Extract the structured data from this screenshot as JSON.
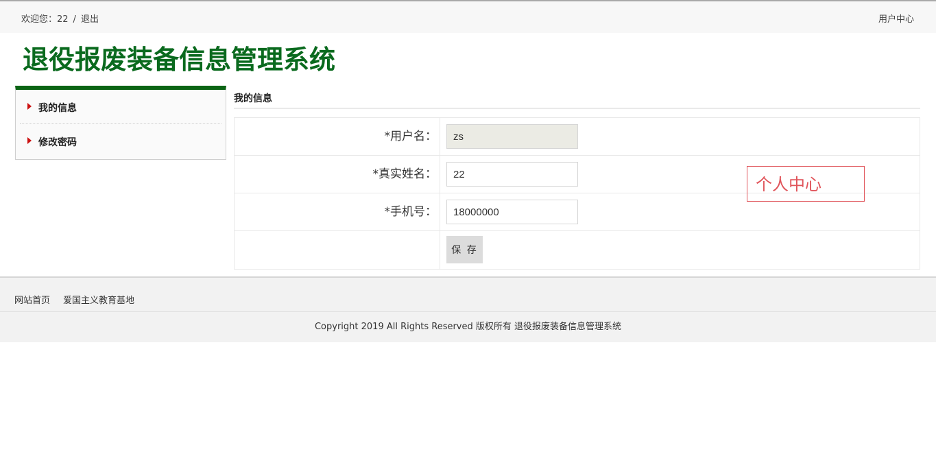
{
  "topbar": {
    "welcome": "欢迎您：22",
    "separator": "/",
    "logout": "退出",
    "user_center": "用户中心"
  },
  "site_title": "退役报废装备信息管理系统",
  "sidebar": {
    "items": [
      {
        "label": "我的信息"
      },
      {
        "label": "修改密码"
      }
    ]
  },
  "main": {
    "heading": "我的信息",
    "form": {
      "username_label": "*用户名：",
      "username_value": "zs",
      "realname_label": "*真实姓名：",
      "realname_value": "22",
      "phone_label": "*手机号：",
      "phone_value": "18000000",
      "save_label": "保 存"
    }
  },
  "annotation": "个人中心",
  "footer": {
    "links": [
      "网站首页",
      "爱国主义教育基地"
    ],
    "copyright": "Copyright 2019 All Rights Reserved 版权所有 退役报废装备信息管理系统"
  },
  "colors": {
    "title_green": "#0a6a1e",
    "sidebar_accent": "#0b6414",
    "arrow_red": "#cc1111",
    "annotation_red": "#e0545a"
  },
  "icons": {
    "sidebar_arrow": "caret-right-icon"
  }
}
